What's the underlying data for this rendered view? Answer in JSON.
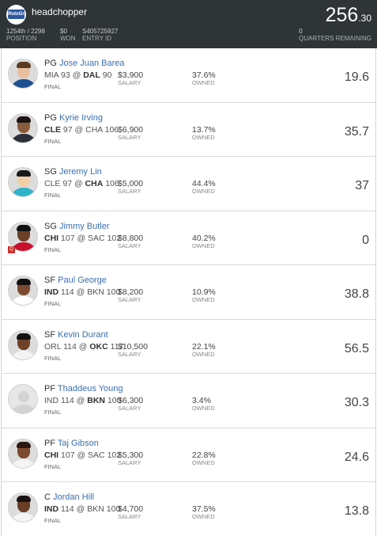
{
  "header": {
    "logo_text": "RotoGrinders",
    "username": "headchopper",
    "position_rank": "1254th",
    "position_total": "/ 2298",
    "position_label": "Position",
    "won_value": "$0",
    "won_label": "Won",
    "entry_id_value": "S405725927",
    "entry_id_label": "Entry ID",
    "score_int": "256",
    "score_dec": ".30",
    "quarters_value": "0",
    "quarters_label": "Quarters Remaining"
  },
  "players": [
    {
      "pos": "PG",
      "name": "Jose Juan Barea",
      "team1": "MIA",
      "score1": "93",
      "team2": "DAL",
      "score2": "90",
      "bold_team": 2,
      "status": "Final",
      "salary": "$3,900",
      "salary_label": "Salary",
      "owned": "37.6%",
      "owned_label": "Owned",
      "fpts": "19.6",
      "jersey": "#1d4f91",
      "skin": "#e8c0a0",
      "hair": "#5a3b22",
      "avatar": "photo"
    },
    {
      "pos": "PG",
      "name": "Kyrie Irving",
      "team1": "CLE",
      "score1": "97",
      "team2": "CHA",
      "score2": "106",
      "bold_team": 1,
      "status": "Final",
      "salary": "$6,900",
      "salary_label": "Salary",
      "owned": "13.7%",
      "owned_label": "Owned",
      "fpts": "35.7",
      "jersey": "#2b2f3a",
      "skin": "#8a5a3c",
      "hair": "#1c1410",
      "avatar": "photo"
    },
    {
      "pos": "SG",
      "name": "Jeremy Lin",
      "team1": "CLE",
      "score1": "97",
      "team2": "CHA",
      "score2": "106",
      "bold_team": 2,
      "status": "Final",
      "salary": "$5,000",
      "salary_label": "Salary",
      "owned": "44.4%",
      "owned_label": "Owned",
      "fpts": "37",
      "jersey": "#2fb3c9",
      "skin": "#f0cfa8",
      "hair": "#1a1a1a",
      "avatar": "photo"
    },
    {
      "pos": "SG",
      "name": "Jimmy Butler",
      "team1": "CHI",
      "score1": "107",
      "team2": "SAC",
      "score2": "102",
      "bold_team": 1,
      "status": "Final",
      "salary": "$8,800",
      "salary_label": "Salary",
      "owned": "40.2%",
      "owned_label": "Owned",
      "fpts": "0",
      "jersey": "#c8102e",
      "skin": "#6b3f28",
      "hair": "#111111",
      "avatar": "photo",
      "flag": "Q"
    },
    {
      "pos": "SF",
      "name": "Paul George",
      "team1": "IND",
      "score1": "114",
      "team2": "BKN",
      "score2": "100",
      "bold_team": 1,
      "status": "Final",
      "salary": "$8,200",
      "salary_label": "Salary",
      "owned": "10.9%",
      "owned_label": "Owned",
      "fpts": "38.8",
      "jersey": "#ffffff",
      "skin": "#7a4a2e",
      "hair": "#141010",
      "avatar": "photo"
    },
    {
      "pos": "SF",
      "name": "Kevin Durant",
      "team1": "ORL",
      "score1": "114",
      "team2": "OKC",
      "score2": "117",
      "bold_team": 2,
      "status": "Final",
      "salary": "$10,500",
      "salary_label": "Salary",
      "owned": "22.1%",
      "owned_label": "Owned",
      "fpts": "56.5",
      "jersey": "#f4f4f4",
      "skin": "#6e4128",
      "hair": "#141010",
      "avatar": "photo"
    },
    {
      "pos": "PF",
      "name": "Thaddeus Young",
      "team1": "IND",
      "score1": "114",
      "team2": "BKN",
      "score2": "100",
      "bold_team": 2,
      "status": "Final",
      "salary": "$6,300",
      "salary_label": "Salary",
      "owned": "3.4%",
      "owned_label": "Owned",
      "fpts": "30.3",
      "avatar": "blank"
    },
    {
      "pos": "PF",
      "name": "Taj Gibson",
      "team1": "CHI",
      "score1": "107",
      "team2": "SAC",
      "score2": "102",
      "bold_team": 1,
      "status": "Final",
      "salary": "$5,300",
      "salary_label": "Salary",
      "owned": "22.8%",
      "owned_label": "Owned",
      "fpts": "24.6",
      "jersey": "#f4f4f4",
      "skin": "#7b4a2f",
      "hair": "#2a1a12",
      "avatar": "photo"
    },
    {
      "pos": "C",
      "name": "Jordan Hill",
      "team1": "IND",
      "score1": "114",
      "team2": "BKN",
      "score2": "100",
      "bold_team": 1,
      "status": "Final",
      "salary": "$4,700",
      "salary_label": "Salary",
      "owned": "37.5%",
      "owned_label": "Owned",
      "fpts": "13.8",
      "jersey": "#f4f4f4",
      "skin": "#6a3e26",
      "hair": "#1a1210",
      "avatar": "photo"
    }
  ]
}
